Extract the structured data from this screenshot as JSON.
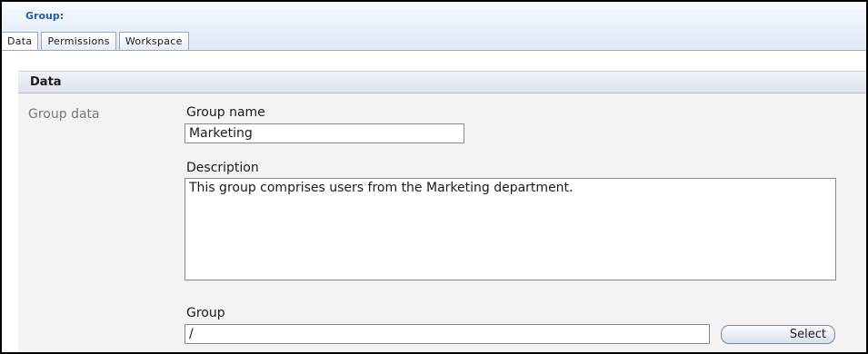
{
  "header": {
    "title": "Group:",
    "tabs": [
      {
        "label": "Data",
        "active": true
      },
      {
        "label": "Permissions",
        "active": false
      },
      {
        "label": "Workspace",
        "active": false
      }
    ]
  },
  "panel": {
    "title": "Data",
    "section_label": "Group data",
    "fields": {
      "group_name": {
        "label": "Group name",
        "value": "Marketing"
      },
      "description": {
        "label": "Description",
        "value": "This group comprises users from the Marketing department."
      },
      "group": {
        "label": "Group",
        "value": "/"
      }
    },
    "select_button": "Select"
  },
  "colors": {
    "accent": "#1f5fa8",
    "header_gradient_end": "#dfe8f7",
    "panel_background": "#f3f3f3",
    "section_label": "#777777"
  }
}
